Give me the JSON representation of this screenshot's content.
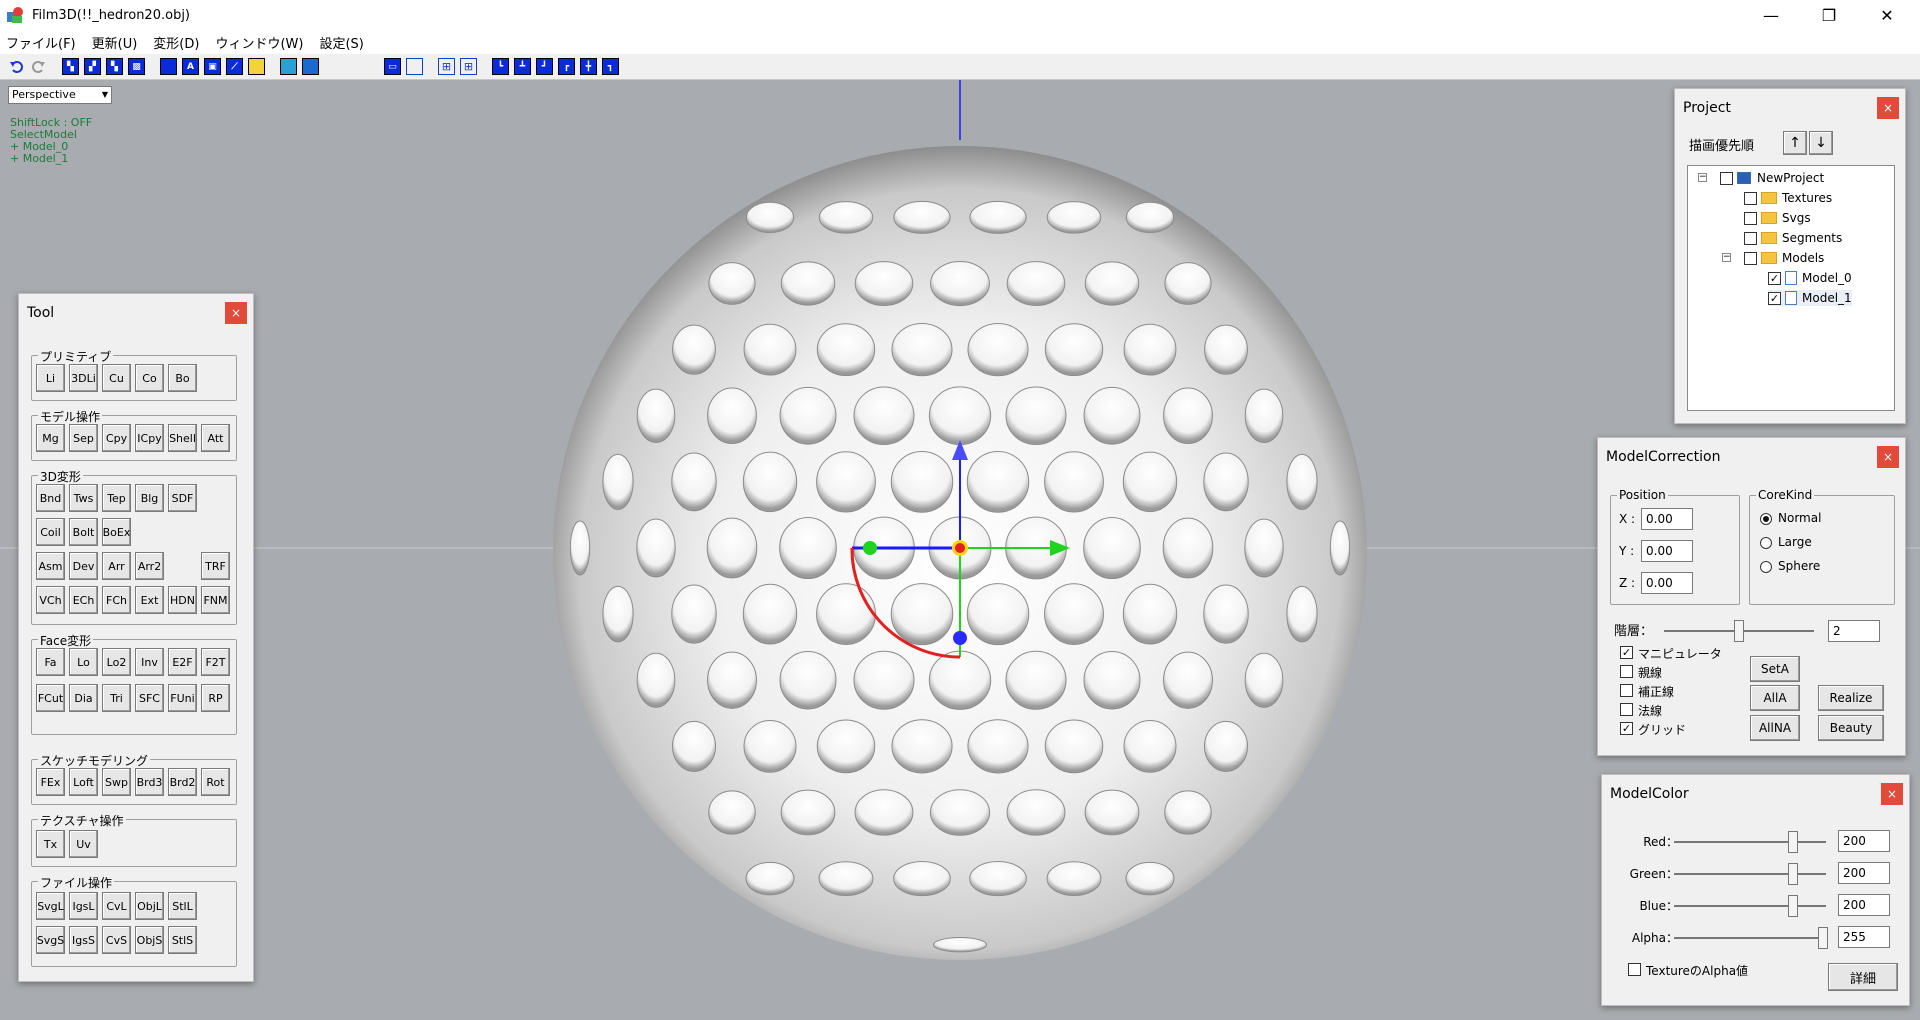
{
  "window": {
    "title": "Film3D(!!_hedron20.obj)",
    "min": "—",
    "max": "❐",
    "close": "✕"
  },
  "menu": [
    "ファイル(F)",
    "更新(U)",
    "変形(D)",
    "ウィンドウ(W)",
    "設定(S)"
  ],
  "viewport": {
    "mode": "Perspective",
    "status": [
      "ShiftLock : OFF",
      "SelectModel",
      "+ Model_0",
      "+ Model_1"
    ]
  },
  "tool": {
    "title": "Tool",
    "close": "×",
    "primitive": {
      "label": "プリミティブ",
      "buttons": [
        "Li",
        "3DLi",
        "Cu",
        "Co",
        "Bo"
      ]
    },
    "model_ops": {
      "label": "モデル操作",
      "buttons": [
        "Mg",
        "Sep",
        "Cpy",
        "ICpy",
        "Shell",
        "Att"
      ]
    },
    "deform3d": {
      "label": "3D変形",
      "row1": [
        "Bnd",
        "Tws",
        "Tep",
        "Blg",
        "SDF"
      ],
      "row2": [
        "Coil",
        "Bolt",
        "BoEx"
      ],
      "row3": [
        "Asm",
        "Dev",
        "Arr",
        "Arr2"
      ],
      "row3b": "TRF",
      "row4": [
        "VCh",
        "ECh",
        "FCh",
        "Ext",
        "HDN",
        "FNM"
      ]
    },
    "face": {
      "label": "Face変形",
      "row1": [
        "Fa",
        "Lo",
        "Lo2",
        "Inv",
        "E2F",
        "F2T"
      ],
      "row2": [
        "FCut",
        "Dia",
        "Tri",
        "SFC",
        "FUni",
        "RP"
      ]
    },
    "sketch": {
      "label": "スケッチモデリング",
      "buttons": [
        "FEx",
        "Loft",
        "Swp",
        "Brd3",
        "Brd2",
        "Rot"
      ]
    },
    "texture": {
      "label": "テクスチャ操作",
      "buttons": [
        "Tx",
        "Uv"
      ]
    },
    "file": {
      "label": "ファイル操作",
      "row1": [
        "SvgL",
        "IgsL",
        "CvL",
        "ObjL",
        "StlL"
      ],
      "row2": [
        "SvgS",
        "IgsS",
        "CvS",
        "ObjS",
        "StlS"
      ]
    }
  },
  "project": {
    "title": "Project",
    "close": "×",
    "priority_label": "描画優先順",
    "up": "↑",
    "down": "↓",
    "tree": [
      {
        "label": "NewProject",
        "checked": false
      },
      {
        "label": "Textures",
        "checked": false
      },
      {
        "label": "Svgs",
        "checked": false
      },
      {
        "label": "Segments",
        "checked": false
      },
      {
        "label": "Models",
        "checked": false
      },
      {
        "label": "Model_0",
        "checked": true
      },
      {
        "label": "Model_1",
        "checked": true
      }
    ]
  },
  "model_correction": {
    "title": "ModelCorrection",
    "close": "×",
    "position": {
      "label": "Position",
      "x_label": "X :",
      "y_label": "Y :",
      "z_label": "Z :",
      "x": "0.00",
      "y": "0.00",
      "z": "0.00"
    },
    "corekind": {
      "label": "CoreKind",
      "options": [
        "Normal",
        "Large",
        "Sphere"
      ],
      "selected": "Normal"
    },
    "layer_label": "階層：",
    "layer": "2",
    "layer_fraction": 0.5,
    "checks": [
      {
        "label": "マニピュレータ",
        "checked": true
      },
      {
        "label": "親線",
        "checked": false
      },
      {
        "label": "補正線",
        "checked": false
      },
      {
        "label": "法線",
        "checked": false
      },
      {
        "label": "グリッド",
        "checked": true
      }
    ],
    "buttons": {
      "seta": "SetA",
      "alla": "AllA",
      "allna": "AllNA",
      "realize": "Realize",
      "beauty": "Beauty"
    }
  },
  "model_color": {
    "title": "ModelColor",
    "close": "×",
    "red_label": "Red：",
    "green_label": "Green：",
    "blue_label": "Blue：",
    "alpha_label": "Alpha：",
    "red": "200",
    "green": "200",
    "blue": "200",
    "alpha": "255",
    "texture_alpha_label": "TextureのAlpha値",
    "texture_alpha_checked": false,
    "detail_button": "詳細"
  },
  "colors": {
    "close": "#e24a3c",
    "viewport": "#a8abaf",
    "axis_x": "#1fd31f",
    "axis_y": "#3030ff",
    "axis_z": "#1fd31f"
  }
}
